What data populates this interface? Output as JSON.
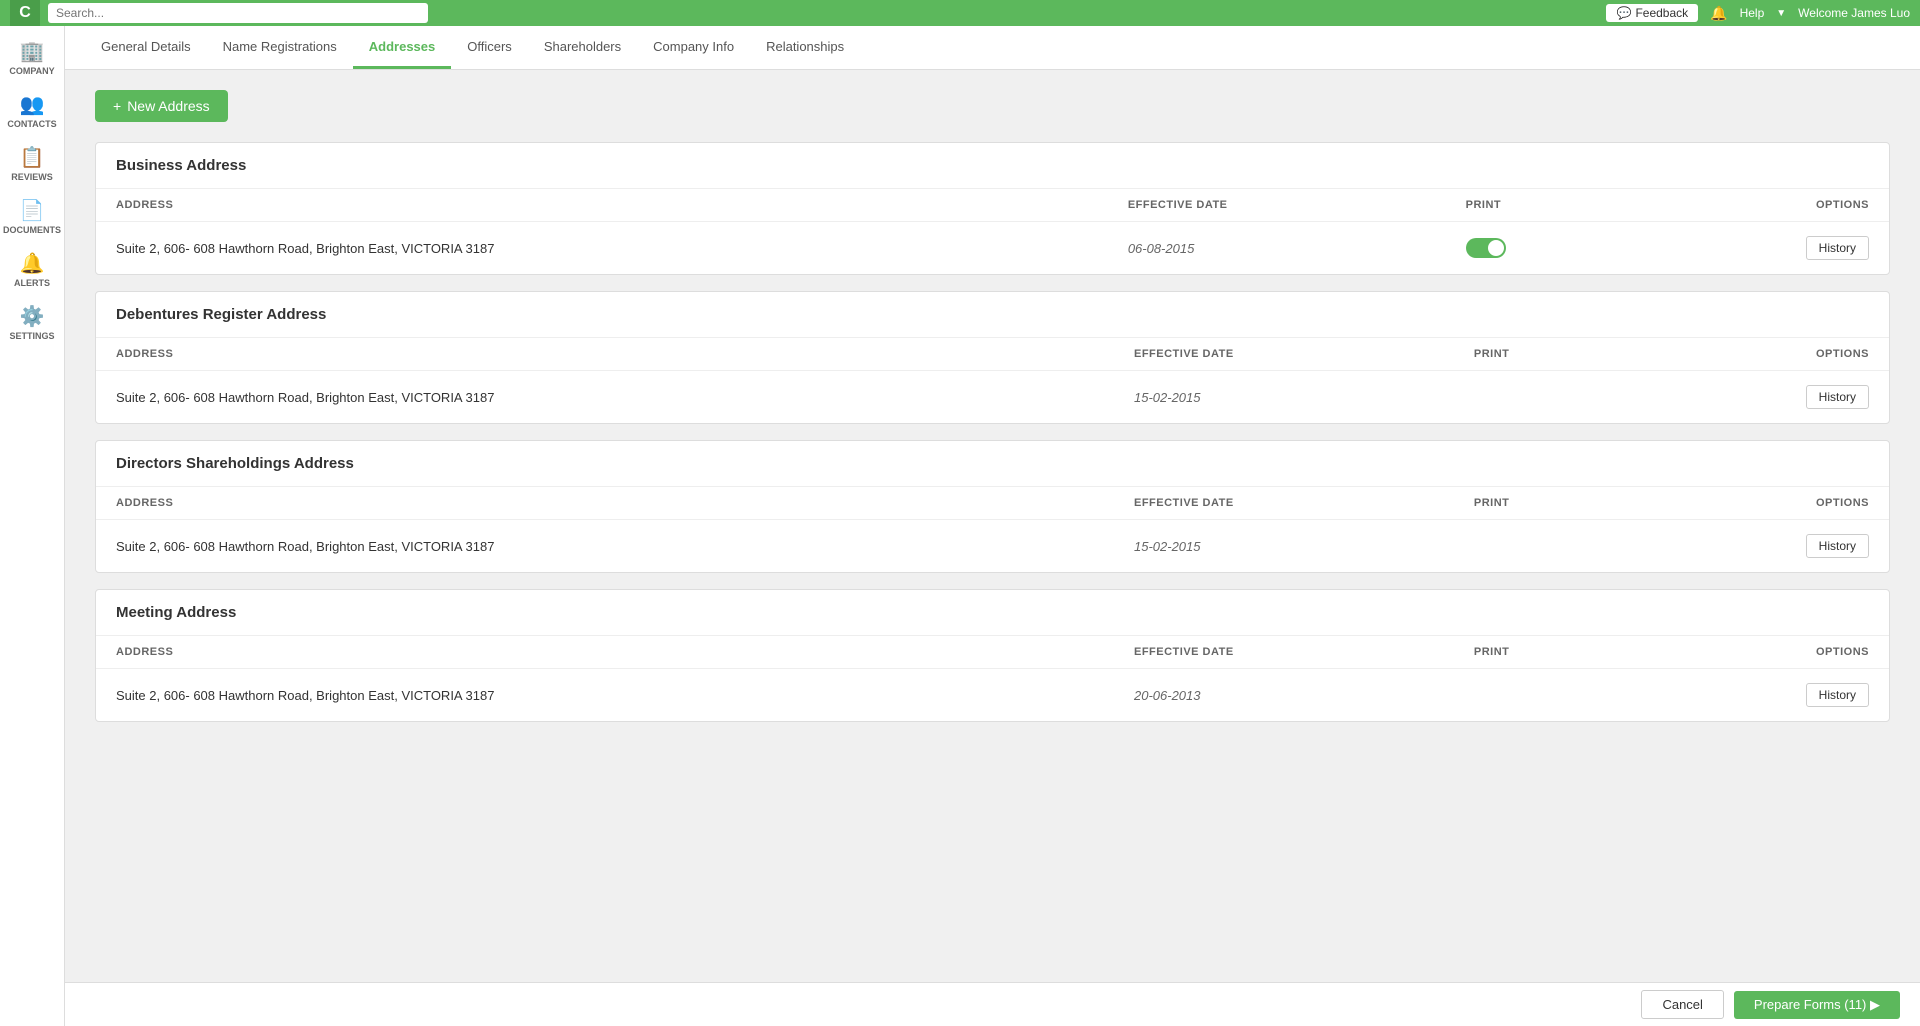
{
  "topbar": {
    "logo": "C",
    "search_placeholder": "Search...",
    "feedback_label": "Feedback",
    "feedback_icon": "💬",
    "bell_icon": "🔔",
    "help_label": "Help",
    "dropdown_arrow": "▼",
    "welcome_text": "Welcome James Luo"
  },
  "sidebar": {
    "items": [
      {
        "id": "company",
        "label": "COMPANY",
        "icon": "🏢"
      },
      {
        "id": "contacts",
        "label": "CONTACTS",
        "icon": "👥"
      },
      {
        "id": "reviews",
        "label": "REVIEWS",
        "icon": "📋"
      },
      {
        "id": "documents",
        "label": "DOCUMENTS",
        "icon": "📄"
      },
      {
        "id": "alerts",
        "label": "ALERTS",
        "icon": "🔔"
      },
      {
        "id": "settings",
        "label": "SETTINGS",
        "icon": "⚙️"
      }
    ]
  },
  "tabs": [
    {
      "id": "general-details",
      "label": "General Details",
      "active": false
    },
    {
      "id": "name-registrations",
      "label": "Name Registrations",
      "active": false
    },
    {
      "id": "addresses",
      "label": "Addresses",
      "active": true
    },
    {
      "id": "officers",
      "label": "Officers",
      "active": false
    },
    {
      "id": "shareholders",
      "label": "Shareholders",
      "active": false
    },
    {
      "id": "company-info",
      "label": "Company Info",
      "active": false
    },
    {
      "id": "relationships",
      "label": "Relationships",
      "active": false
    }
  ],
  "new_address_button": "New Address",
  "address_sections": [
    {
      "id": "business",
      "title": "Business Address",
      "columns": {
        "address": "ADDRESS",
        "effective_date": "EFFECTIVE DATE",
        "print": "PRINT",
        "options": "OPTIONS"
      },
      "rows": [
        {
          "address": "Suite 2, 606- 608 Hawthorn Road, Brighton East, VICTORIA 3187",
          "effective_date": "06-08-2015",
          "print_on": true,
          "history_label": "History"
        }
      ]
    },
    {
      "id": "debentures",
      "title": "Debentures Register Address",
      "columns": {
        "address": "ADDRESS",
        "effective_date": "EFFECTIVE DATE",
        "print": "PRINT",
        "options": "OPTIONS"
      },
      "rows": [
        {
          "address": "Suite 2, 606- 608 Hawthorn Road, Brighton East, VICTORIA 3187",
          "effective_date": "15-02-2015",
          "print_on": false,
          "history_label": "History"
        }
      ]
    },
    {
      "id": "directors",
      "title": "Directors Shareholdings Address",
      "columns": {
        "address": "ADDRESS",
        "effective_date": "EFFECTIVE DATE",
        "print": "PRINT",
        "options": "OPTIONS"
      },
      "rows": [
        {
          "address": "Suite 2, 606- 608 Hawthorn Road, Brighton East, VICTORIA 3187",
          "effective_date": "15-02-2015",
          "print_on": false,
          "history_label": "History"
        }
      ]
    },
    {
      "id": "meeting",
      "title": "Meeting Address",
      "columns": {
        "address": "ADDRESS",
        "effective_date": "EFFECTIVE DATE",
        "print": "PRINT",
        "options": "OPTIONS"
      },
      "rows": [
        {
          "address": "Suite 2, 606- 608 Hawthorn Road, Brighton East, VICTORIA 3187",
          "effective_date": "20-06-2013",
          "print_on": false,
          "history_label": "History"
        }
      ]
    }
  ],
  "bottom_bar": {
    "cancel_label": "Cancel",
    "prepare_forms_label": "Prepare Forms (11) ▶"
  }
}
